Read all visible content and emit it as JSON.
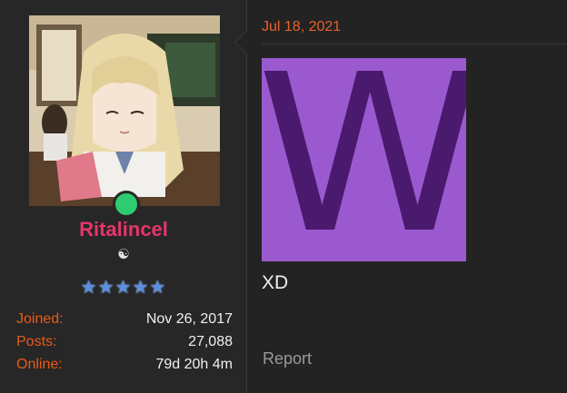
{
  "user": {
    "username": "Ritalincel",
    "symbol": "☯",
    "stars": "★★★★★",
    "online": true,
    "colors": {
      "username": "#e8346b",
      "online": "#2ecc71",
      "label": "#e65c1a"
    },
    "stats": [
      {
        "label": "Joined:",
        "value": "Nov 26, 2017"
      },
      {
        "label": "Posts:",
        "value": "27,088"
      },
      {
        "label": "Online:",
        "value": "79d 20h 4m"
      }
    ]
  },
  "post": {
    "date": "Jul 18, 2021",
    "image_letter": "W",
    "text": "XD",
    "report_label": "Report"
  }
}
